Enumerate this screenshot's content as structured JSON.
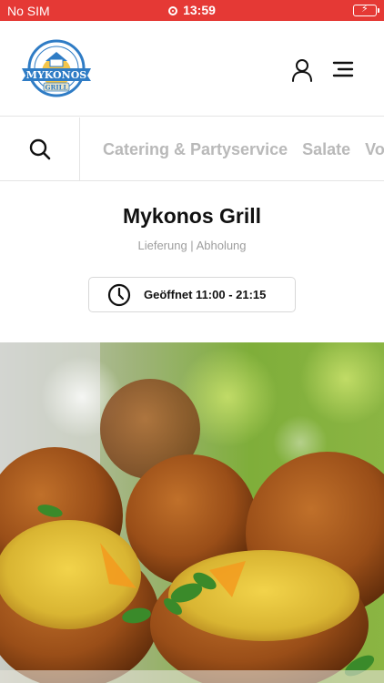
{
  "status_bar": {
    "carrier": "No SIM",
    "time": "13:59",
    "battery_color": "#6fdc4f"
  },
  "header": {
    "logo": {
      "brand_text": "MYKONOS",
      "sub_text": "GRILL",
      "ring_text_top": "Griechisches Restaurant",
      "ring_text_bottom": "Lieferservice & Catering"
    }
  },
  "categories": [
    "Catering & Partyservice",
    "Salate",
    "Vo"
  ],
  "restaurant": {
    "name": "Mykonos Grill",
    "subtitle": "Lieferung | Abholung",
    "hours": "Geöffnet 11:00 - 21:15"
  },
  "colors": {
    "status_bar": "#e53935",
    "category_text": "#b9b9b9",
    "logo_blue": "#2f7cc5"
  },
  "icons": {
    "user": "user-icon",
    "menu": "menu-icon",
    "search": "search-icon",
    "clock": "clock-icon"
  }
}
